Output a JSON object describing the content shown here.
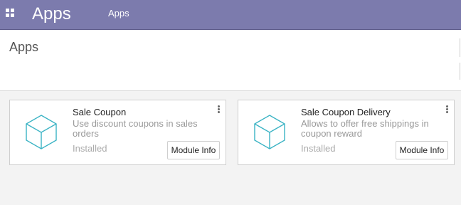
{
  "navbar": {
    "app_title": "Apps",
    "menu_apps": "Apps",
    "bg_color": "#7c7bad"
  },
  "control_panel": {
    "breadcrumb": "Apps"
  },
  "cards": [
    {
      "name": "Sale Coupon",
      "summary": "Use discount coupons in sales orders",
      "status": "Installed",
      "button": "Module Info",
      "icon": "cube-icon"
    },
    {
      "name": "Sale Coupon Delivery",
      "summary": "Allows to offer free shippings in coupon reward",
      "status": "Installed",
      "button": "Module Info",
      "icon": "cube-icon"
    }
  ],
  "colors": {
    "accent": "#7c7bad",
    "icon_stroke": "#3ab3c4"
  }
}
